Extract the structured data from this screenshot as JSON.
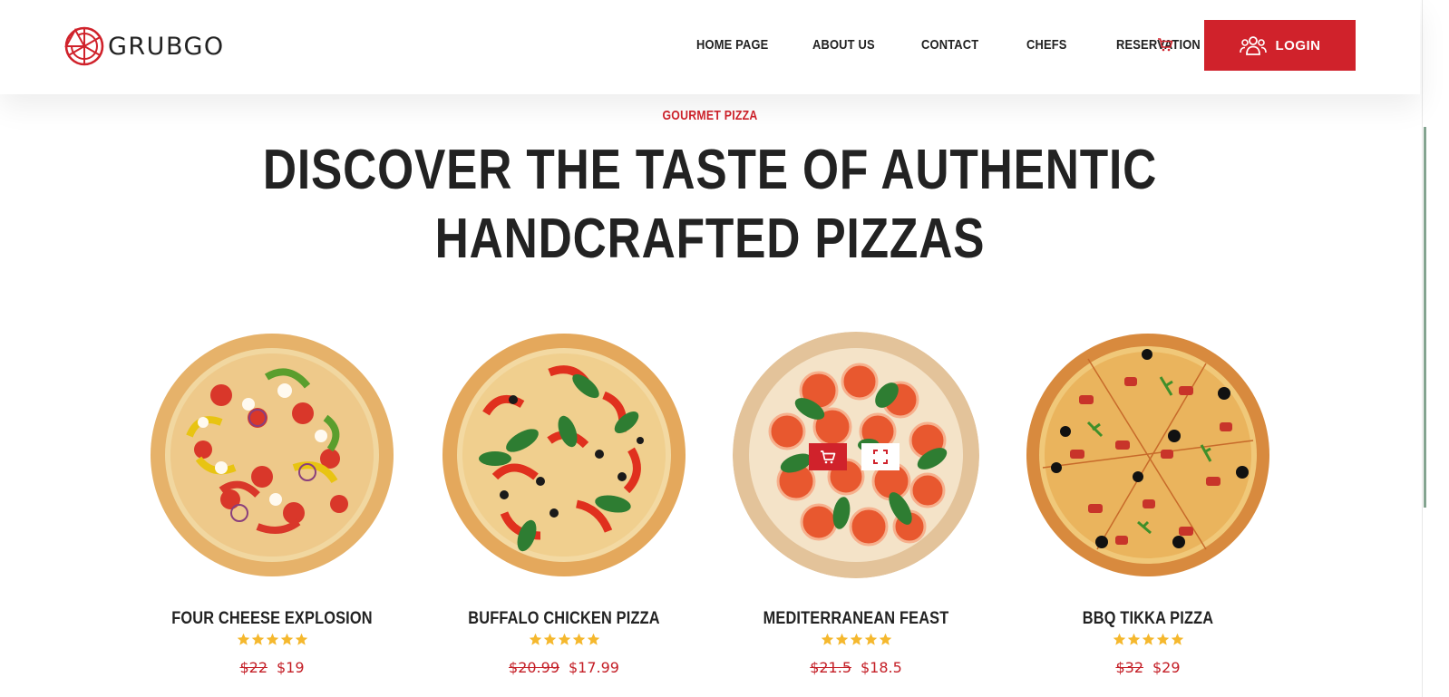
{
  "brand": {
    "name": "GRUBGO",
    "accent": "#d0222b"
  },
  "nav": {
    "items": [
      {
        "label": "HOME PAGE"
      },
      {
        "label": "ABOUT US"
      },
      {
        "label": "CONTACT"
      },
      {
        "label": "CHEFS"
      },
      {
        "label": "RESERVATION"
      }
    ],
    "cart_icon": "cart-icon",
    "login_label": "LOGIN",
    "login_icon": "users-icon"
  },
  "hero": {
    "eyebrow": "GOURMET PIZZA",
    "headline_line1": "DISCOVER THE TASTE OF AUTHENTIC",
    "headline_line2": "HANDCRAFTED PIZZAS"
  },
  "products": [
    {
      "name": "FOUR CHEESE EXPLOSION",
      "old_price": "$22",
      "price": "$19",
      "rating": 5
    },
    {
      "name": "BUFFALO CHICKEN PIZZA",
      "old_price": "$20.99",
      "price": "$17.99",
      "rating": 5
    },
    {
      "name": "MEDITERRANEAN FEAST",
      "old_price": "$21.5",
      "price": "$18.5",
      "rating": 5
    },
    {
      "name": "BBQ TIKKA PIZZA",
      "old_price": "$32",
      "price": "$29",
      "rating": 5
    }
  ],
  "star_color": "#f5b82e"
}
